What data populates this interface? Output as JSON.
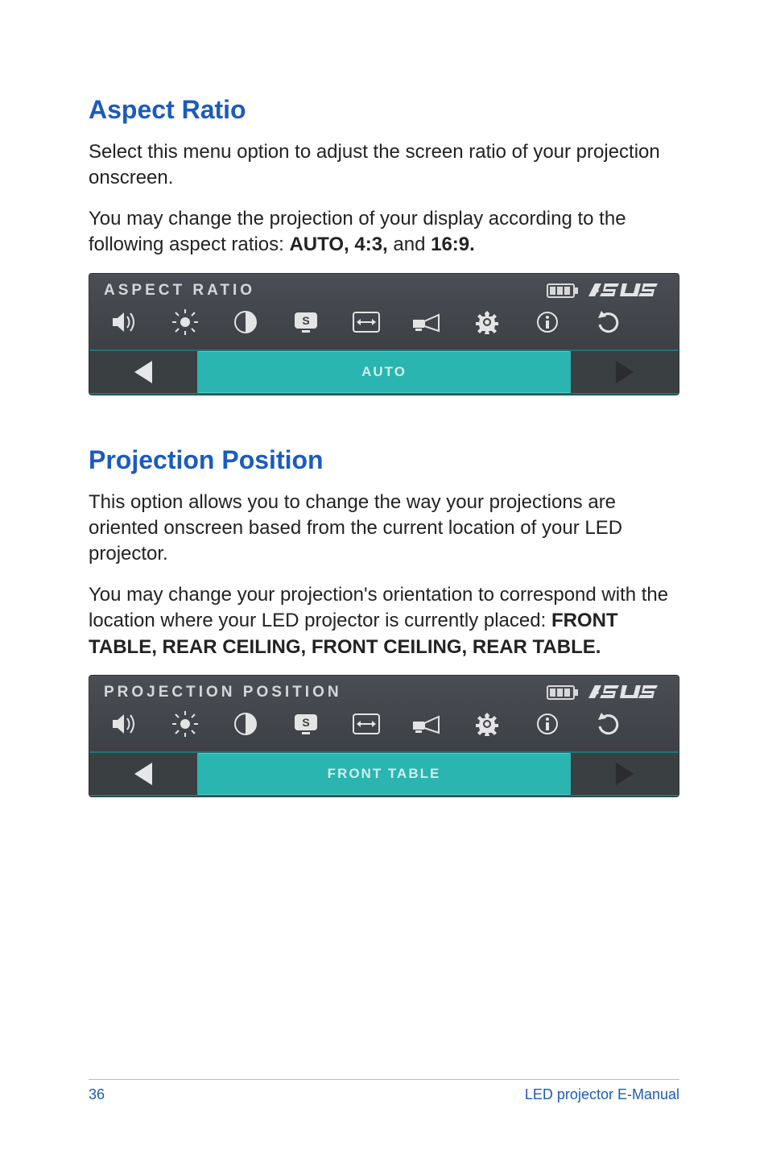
{
  "sections": {
    "aspect": {
      "heading": "Aspect Ratio",
      "p1": "Select this menu option to adjust the screen ratio of your projection onscreen.",
      "p2_a": "You may change the projection of your display according to the following aspect ratios: ",
      "p2_b": "AUTO, 4:3,",
      "p2_c": " and ",
      "p2_d": "16:9."
    },
    "projection": {
      "heading": "Projection Position",
      "p1": "This option allows you to change the way your projections are oriented onscreen based from the current location of your LED projector.",
      "p2_a": "You may change your projection's orientation to correspond with the location where your LED projector is currently placed: ",
      "p2_b": "FRONT TABLE, REAR CEILING, FRONT CEILING, REAR TABLE."
    }
  },
  "osd": {
    "aspect": {
      "title": "ASPECT RATIO",
      "value": "AUTO"
    },
    "projection": {
      "title": "PROJECTION POSITION",
      "value": "FRONT TABLE"
    }
  },
  "icons": {
    "volume": "volume-icon",
    "brightness": "brightness-icon",
    "contrast": "contrast-icon",
    "splendid": "splendid-icon",
    "aspect": "aspect-ratio-icon",
    "position": "projection-position-icon",
    "settings": "settings-icon",
    "info": "info-icon",
    "reset": "reset-icon"
  },
  "footer": {
    "page": "36",
    "doc": "LED projector E-Manual"
  }
}
